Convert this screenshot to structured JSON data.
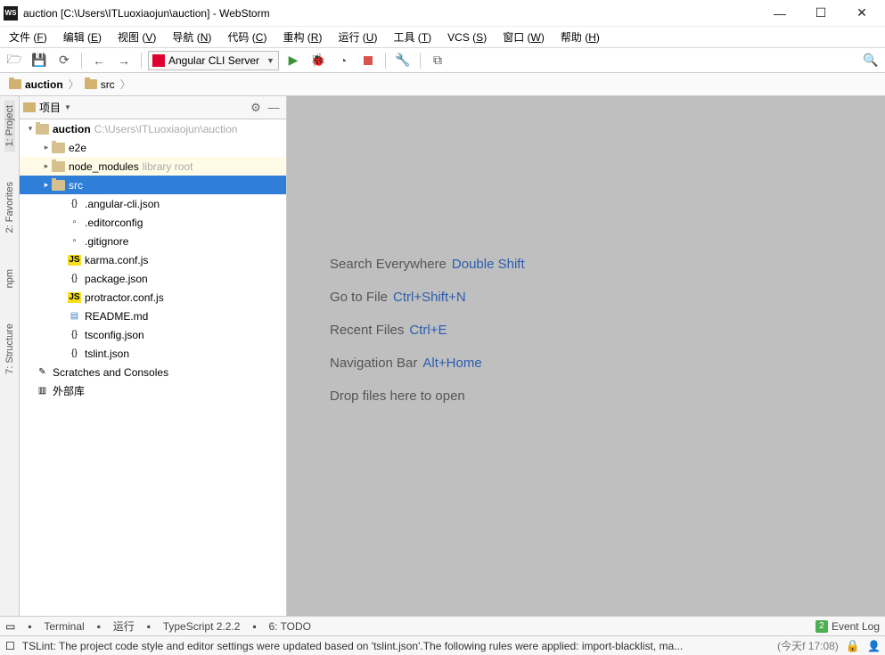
{
  "window": {
    "title": "auction [C:\\Users\\ITLuoxiaojun\\auction] - WebStorm",
    "app_icon": "WS"
  },
  "menu": {
    "items": [
      {
        "label": "文件",
        "key": "F"
      },
      {
        "label": "编辑",
        "key": "E"
      },
      {
        "label": "视图",
        "key": "V"
      },
      {
        "label": "导航",
        "key": "N"
      },
      {
        "label": "代码",
        "key": "C"
      },
      {
        "label": "重构",
        "key": "R"
      },
      {
        "label": "运行",
        "key": "U"
      },
      {
        "label": "工具",
        "key": "T"
      },
      {
        "label": "VCS",
        "key": "S"
      },
      {
        "label": "窗口",
        "key": "W"
      },
      {
        "label": "帮助",
        "key": "H"
      }
    ]
  },
  "toolbar": {
    "run_config": "Angular CLI Server"
  },
  "breadcrumb": {
    "items": [
      {
        "label": "auction",
        "bold": true
      },
      {
        "label": "src",
        "bold": false
      }
    ]
  },
  "panel": {
    "title": "项目",
    "tree": [
      {
        "indent": 0,
        "arrow": "▾",
        "icon": "folder",
        "label": "auction",
        "hint": "C:\\Users\\ITLuoxiaojun\\auction",
        "root": true
      },
      {
        "indent": 1,
        "arrow": "▸",
        "icon": "folder",
        "label": "e2e"
      },
      {
        "indent": 1,
        "arrow": "▸",
        "icon": "folder",
        "label": "node_modules",
        "hint": "library root",
        "highlight": true
      },
      {
        "indent": 1,
        "arrow": "▸",
        "icon": "folder",
        "label": "src",
        "selected": true
      },
      {
        "indent": 2,
        "arrow": "",
        "icon": "json",
        "label": ".angular-cli.json"
      },
      {
        "indent": 2,
        "arrow": "",
        "icon": "file",
        "label": ".editorconfig"
      },
      {
        "indent": 2,
        "arrow": "",
        "icon": "file",
        "label": ".gitignore"
      },
      {
        "indent": 2,
        "arrow": "",
        "icon": "js",
        "label": "karma.conf.js"
      },
      {
        "indent": 2,
        "arrow": "",
        "icon": "json",
        "label": "package.json"
      },
      {
        "indent": 2,
        "arrow": "",
        "icon": "js",
        "label": "protractor.conf.js"
      },
      {
        "indent": 2,
        "arrow": "",
        "icon": "md",
        "label": "README.md"
      },
      {
        "indent": 2,
        "arrow": "",
        "icon": "json",
        "label": "tsconfig.json"
      },
      {
        "indent": 2,
        "arrow": "",
        "icon": "json",
        "label": "tslint.json"
      },
      {
        "indent": 0,
        "arrow": "",
        "icon": "scratch",
        "label": "Scratches and Consoles"
      },
      {
        "indent": 0,
        "arrow": "",
        "icon": "ext",
        "label": "外部库"
      }
    ]
  },
  "left_tool_windows": [
    {
      "label": "1: Project"
    },
    {
      "label": "2: Favorites"
    },
    {
      "label": "npm"
    },
    {
      "label": "7: Structure"
    }
  ],
  "welcome": [
    {
      "text": "Search Everywhere",
      "shortcut": "Double Shift"
    },
    {
      "text": "Go to File",
      "shortcut": "Ctrl+Shift+N"
    },
    {
      "text": "Recent Files",
      "shortcut": "Ctrl+E"
    },
    {
      "text": "Navigation Bar",
      "shortcut": "Alt+Home"
    },
    {
      "text": "Drop files here to open",
      "shortcut": ""
    }
  ],
  "bottom_tools": {
    "items": [
      {
        "label": "Terminal"
      },
      {
        "label": "运行"
      },
      {
        "label": "TypeScript 2.2.2"
      },
      {
        "label": "6: TODO"
      }
    ],
    "event_log": "Event Log",
    "event_count": "2"
  },
  "status": {
    "msg": "TSLint: The project code style and editor settings were updated based on 'tslint.json'.The following rules were applied: import-blacklist, ma...",
    "time": "(今天f 17:08)"
  }
}
